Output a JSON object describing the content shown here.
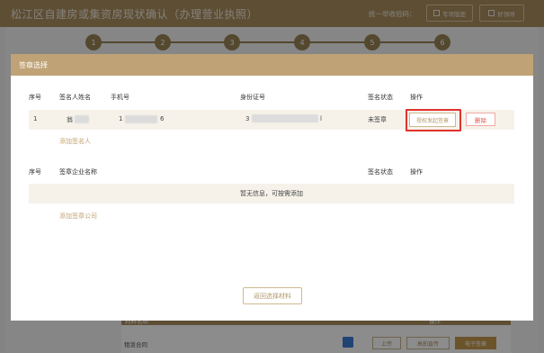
{
  "background": {
    "title": "松江区自建房或集资房现状确认（办理营业执照）",
    "credit_code_label": "统一举收验码：",
    "buttons": [
      "专项版面",
      "好领呀"
    ],
    "steps": [
      "1",
      "2",
      "3",
      "4",
      "5",
      "6"
    ],
    "table": {
      "headers": [
        "材料名称",
        "操作"
      ],
      "row_name": "租赁合同",
      "row_buttons": [
        "上传",
        "高拍直传",
        "电子签章"
      ]
    }
  },
  "modal": {
    "title": "签章选择",
    "signers": {
      "headers": [
        "序号",
        "签名人姓名",
        "手机号",
        "身份证号",
        "签名状态",
        "操作"
      ],
      "rows": [
        {
          "index": "1",
          "name": "翁",
          "phone_start": "1",
          "phone_end": "6",
          "id_start": "3",
          "id_end": "l",
          "status": "未签章",
          "auth_button": "授权发起签章",
          "delete_button": "删除"
        }
      ],
      "add_link": "添加签名人"
    },
    "companies": {
      "headers": [
        "序号",
        "签章企业名称",
        "签名状态",
        "操作"
      ],
      "empty_text": "暂无信息，可按需添加",
      "add_link": "添加签章公司"
    },
    "return_button": "返回选择材料"
  },
  "colors": {
    "accent": "#bfa275",
    "highlight": "#e0322c",
    "danger": "#e0564f"
  }
}
